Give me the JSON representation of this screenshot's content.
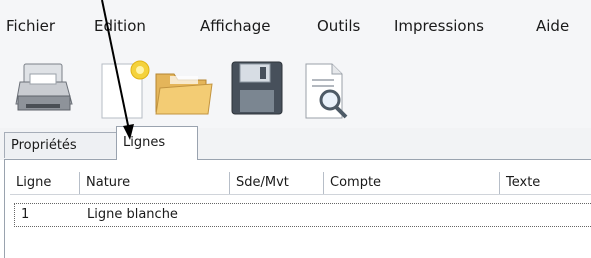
{
  "menu": {
    "items": [
      "Fichier",
      "Edition",
      "Affichage",
      "Outils",
      "Impressions",
      "Aide"
    ]
  },
  "toolbar": {
    "buttons": [
      {
        "icon": "printer-icon"
      },
      {
        "icon": "new-document-icon"
      },
      {
        "icon": "open-folder-icon"
      },
      {
        "icon": "save-floppy-icon"
      },
      {
        "icon": "print-preview-icon"
      }
    ]
  },
  "tabs": {
    "proprietes": "Propriétés",
    "lignes": "Lignes"
  },
  "grid": {
    "columns": [
      "Ligne",
      "Nature",
      "Sde/Mvt",
      "Compte",
      "Texte"
    ],
    "rows": [
      {
        "ligne": "1",
        "nature": "Ligne blanche"
      }
    ]
  },
  "colors": {
    "menubar_bg": "#f5f6f8",
    "border": "#9aa3af",
    "arrow": "#000000"
  }
}
